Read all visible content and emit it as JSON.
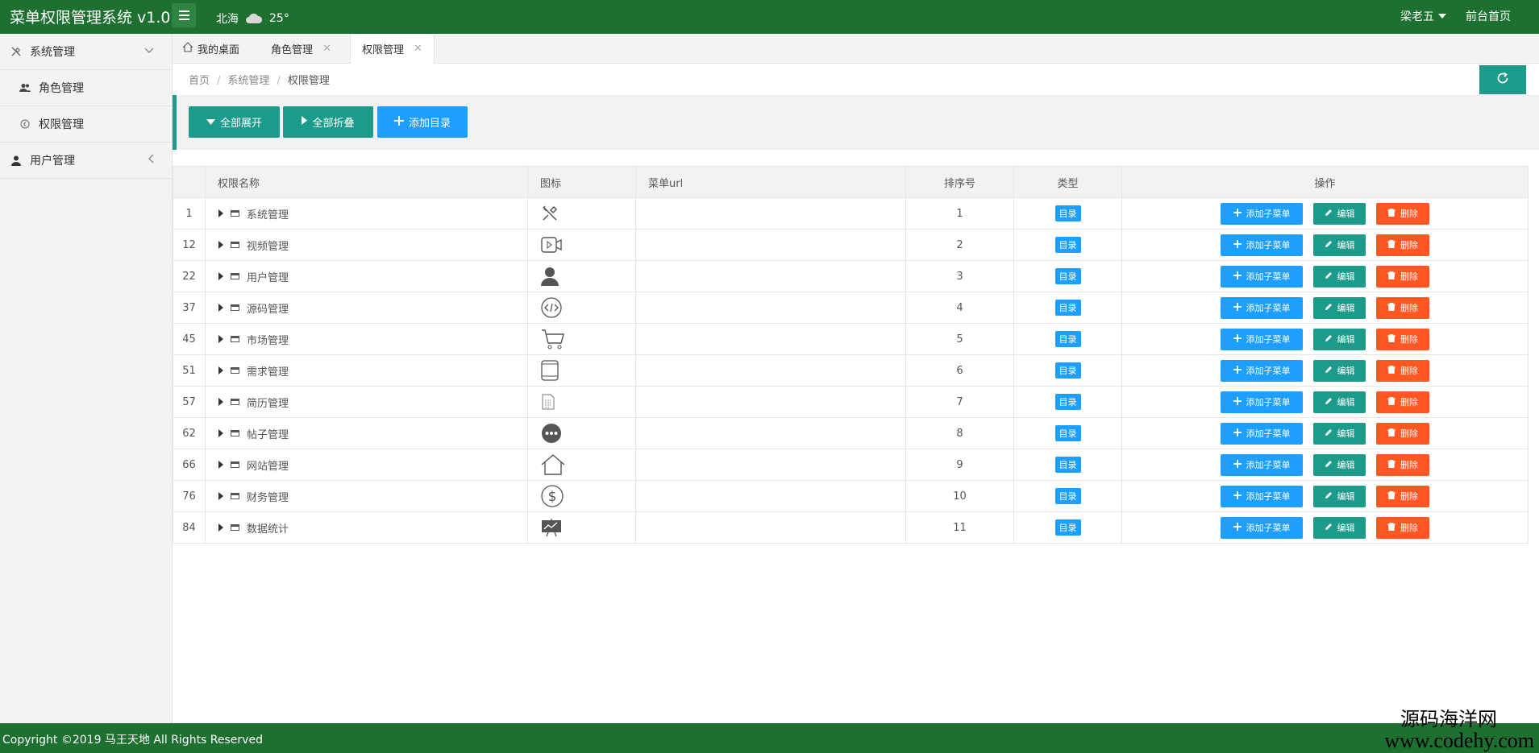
{
  "app": {
    "title": "菜单权限管理系统 v1.0"
  },
  "header": {
    "weather_city": "北海",
    "weather_temp": "25°",
    "user_name": "梁老五",
    "home_link": "前台首页"
  },
  "sidebar": {
    "items": [
      {
        "label": "系统管理",
        "icon": "tools-icon",
        "level": 1,
        "expanded": true
      },
      {
        "label": "角色管理",
        "icon": "users-icon",
        "level": 2
      },
      {
        "label": "权限管理",
        "icon": "circle-arrow-icon",
        "level": 2
      },
      {
        "label": "用户管理",
        "icon": "user-icon",
        "level": 1,
        "expanded": false
      }
    ]
  },
  "tabs": [
    {
      "label": "我的桌面",
      "icon": "home-icon",
      "closable": false
    },
    {
      "label": "角色管理",
      "closable": true
    },
    {
      "label": "权限管理",
      "closable": true,
      "active": true
    }
  ],
  "breadcrumb": [
    "首页",
    "系统管理",
    "权限管理"
  ],
  "toolbar": {
    "expand_all": "全部展开",
    "collapse_all": "全部折叠",
    "add_directory": "添加目录"
  },
  "table": {
    "headers": [
      "",
      "权限名称",
      "图标",
      "菜单url",
      "排序号",
      "类型",
      "操作"
    ],
    "ops": {
      "add": "添加子菜单",
      "edit": "编辑",
      "delete": "删除"
    },
    "rows": [
      {
        "id": "1",
        "name": "系统管理",
        "icon": "tools-icon",
        "url": "",
        "sort": "1",
        "type": "目录"
      },
      {
        "id": "12",
        "name": "视频管理",
        "icon": "video-icon",
        "url": "",
        "sort": "2",
        "type": "目录"
      },
      {
        "id": "22",
        "name": "用户管理",
        "icon": "user-icon",
        "url": "",
        "sort": "3",
        "type": "目录"
      },
      {
        "id": "37",
        "name": "源码管理",
        "icon": "code-icon",
        "url": "",
        "sort": "4",
        "type": "目录"
      },
      {
        "id": "45",
        "name": "市场管理",
        "icon": "cart-icon",
        "url": "",
        "sort": "5",
        "type": "目录"
      },
      {
        "id": "51",
        "name": "需求管理",
        "icon": "tablet-icon",
        "url": "",
        "sort": "6",
        "type": "目录"
      },
      {
        "id": "57",
        "name": "简历管理",
        "icon": "list-icon",
        "url": "",
        "sort": "7",
        "type": "目录"
      },
      {
        "id": "62",
        "name": "帖子管理",
        "icon": "chat-icon",
        "url": "",
        "sort": "8",
        "type": "目录"
      },
      {
        "id": "66",
        "name": "网站管理",
        "icon": "house-icon",
        "url": "",
        "sort": "9",
        "type": "目录"
      },
      {
        "id": "76",
        "name": "财务管理",
        "icon": "dollar-icon",
        "url": "",
        "sort": "10",
        "type": "目录"
      },
      {
        "id": "84",
        "name": "数据统计",
        "icon": "chart-board-icon",
        "url": "",
        "sort": "11",
        "type": "目录"
      }
    ]
  },
  "footer": {
    "copyright": "Copyright ©2019 马王天地 All Rights Reserved"
  },
  "watermark": {
    "line1": "源码海洋网",
    "line2": "www.codehy.com"
  },
  "colors": {
    "header": "#1e7031",
    "teal": "#1d9b8a",
    "blue": "#1e9fff",
    "orange": "#ff5722"
  }
}
